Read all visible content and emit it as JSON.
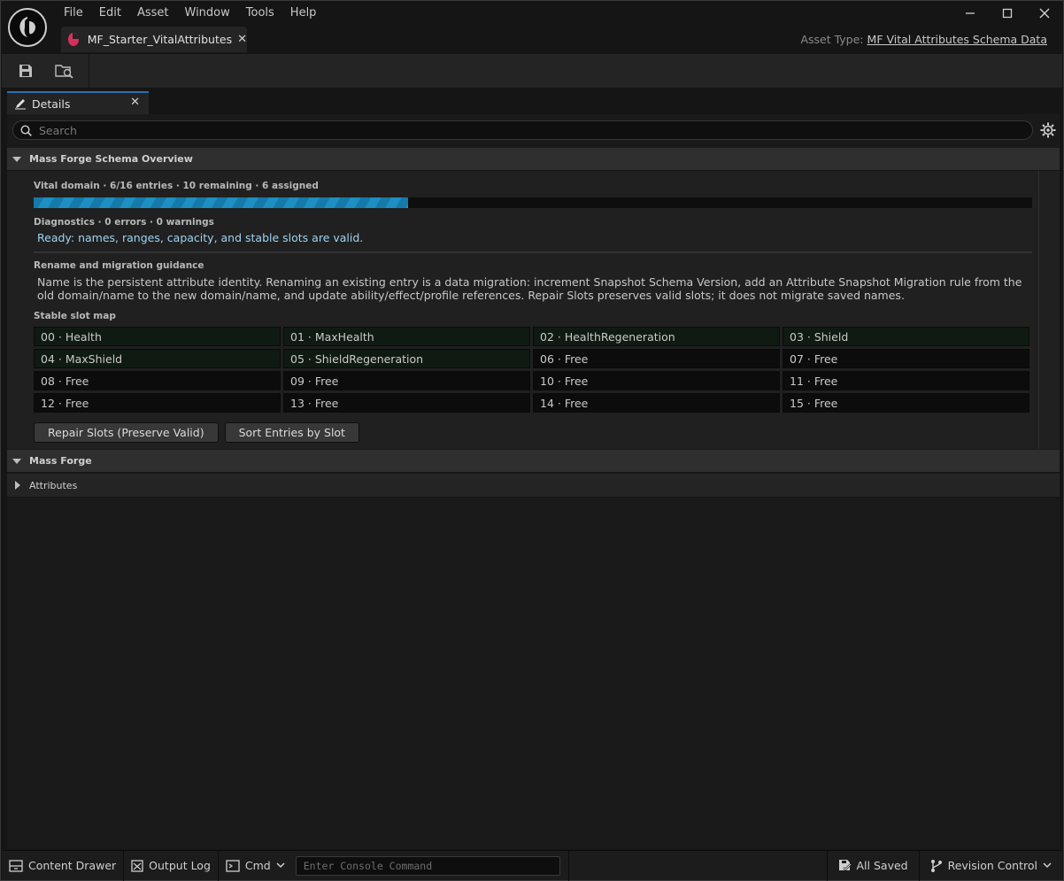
{
  "menu": [
    "File",
    "Edit",
    "Asset",
    "Window",
    "Tools",
    "Help"
  ],
  "asset_tab": {
    "label": "MF_Starter_VitalAttributes"
  },
  "asset_type": {
    "label": "Asset Type:",
    "value": "MF Vital Attributes Schema Data"
  },
  "details_tab": {
    "label": "Details"
  },
  "search": {
    "placeholder": "Search"
  },
  "overview": {
    "category": "Mass Forge Schema Overview",
    "vital_label": "Vital domain · 6/16 entries · 10 remaining · 6 assigned",
    "progress_fraction": 0.375,
    "diagnostics_label": "Diagnostics · 0 errors · 0 warnings",
    "ready_text": "Ready: names, ranges, capacity, and stable slots are valid.",
    "guidance_label": "Rename and migration guidance",
    "guidance_text": "Name is the persistent attribute identity. Renaming an existing entry is a data migration: increment Snapshot Schema Version, add an Attribute Snapshot Migration rule from the old domain/name to the new domain/name, and update ability/effect/profile references. Repair Slots preserves valid slots; it does not migrate saved names.",
    "slot_map_label": "Stable slot map",
    "slots": [
      {
        "text": "00 · Health",
        "assigned": true
      },
      {
        "text": "01 · MaxHealth",
        "assigned": true
      },
      {
        "text": "02 · HealthRegeneration",
        "assigned": true
      },
      {
        "text": "03 · Shield",
        "assigned": true
      },
      {
        "text": "04 · MaxShield",
        "assigned": true
      },
      {
        "text": "05 · ShieldRegeneration",
        "assigned": true
      },
      {
        "text": "06 · Free",
        "assigned": false
      },
      {
        "text": "07 · Free",
        "assigned": false
      },
      {
        "text": "08 · Free",
        "assigned": false
      },
      {
        "text": "09 · Free",
        "assigned": false
      },
      {
        "text": "10 · Free",
        "assigned": false
      },
      {
        "text": "11 · Free",
        "assigned": false
      },
      {
        "text": "12 · Free",
        "assigned": false
      },
      {
        "text": "13 · Free",
        "assigned": false
      },
      {
        "text": "14 · Free",
        "assigned": false
      },
      {
        "text": "15 · Free",
        "assigned": false
      }
    ],
    "repair_button": "Repair Slots (Preserve Valid)",
    "sort_button": "Sort Entries by Slot"
  },
  "mass_forge": {
    "category": "Mass Forge",
    "attributes": "Attributes"
  },
  "statusbar": {
    "content_drawer": "Content Drawer",
    "output_log": "Output Log",
    "cmd": "Cmd",
    "console_placeholder": "Enter Console Command",
    "all_saved": "All Saved",
    "revision_control": "Revision Control"
  },
  "colors": {
    "accent": "#2a6fb0",
    "progress": "#1d8fc2",
    "ready_text": "#9dd3f2",
    "asset_icon": "#d9305a"
  }
}
